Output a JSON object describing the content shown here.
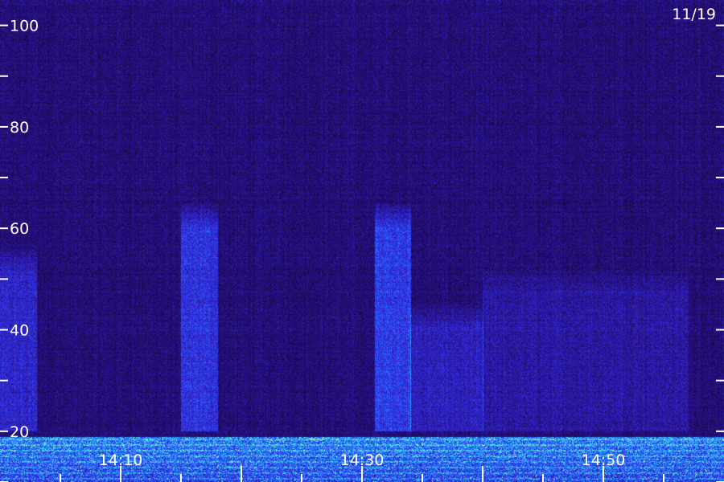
{
  "chart_data": {
    "type": "heatmap",
    "date_label": "11/19",
    "y_axis": {
      "range": [
        10,
        105
      ],
      "major_ticks": [
        10,
        20,
        30,
        40,
        50,
        60,
        70,
        80,
        90,
        100
      ],
      "labeled_ticks": [
        20,
        40,
        60,
        80,
        100
      ],
      "tick_labels": [
        "20",
        "40",
        "60",
        "80",
        "100"
      ]
    },
    "x_axis": {
      "range": [
        "14:00",
        "15:00"
      ],
      "major_ticks": [
        "14:10",
        "14:20",
        "14:30",
        "14:40",
        "14:50",
        "15:00"
      ],
      "minor_interval_minutes": 5,
      "tick_labels": [
        "14:10",
        "14:30",
        "14:50"
      ]
    },
    "features": [
      {
        "kind": "burst",
        "start": "14:00",
        "end": "14:03",
        "y_range": [
          20,
          56
        ],
        "intensity": 0.55
      },
      {
        "kind": "burst",
        "start": "14:15",
        "end": "14:18",
        "y_range": [
          20,
          65
        ],
        "intensity": 0.7
      },
      {
        "kind": "burst",
        "start": "14:31",
        "end": "14:34",
        "y_range": [
          20,
          65
        ],
        "intensity": 0.8
      },
      {
        "kind": "burst",
        "start": "14:34",
        "end": "14:40",
        "y_range": [
          20,
          45
        ],
        "intensity": 0.45
      },
      {
        "kind": "burst",
        "start": "14:40",
        "end": "14:57",
        "y_range": [
          20,
          52
        ],
        "intensity": 0.3
      },
      {
        "kind": "low-frequency band",
        "start": "14:00",
        "end": "15:00",
        "y_range": [
          10,
          19
        ],
        "intensity": 1.0
      }
    ],
    "colors": {
      "background": "#1a0848",
      "low": "#2a14a0",
      "mid": "#3a4cff",
      "high": "#40e0ff",
      "peak": "#b0ffb0",
      "labels": "#ffffff"
    }
  }
}
